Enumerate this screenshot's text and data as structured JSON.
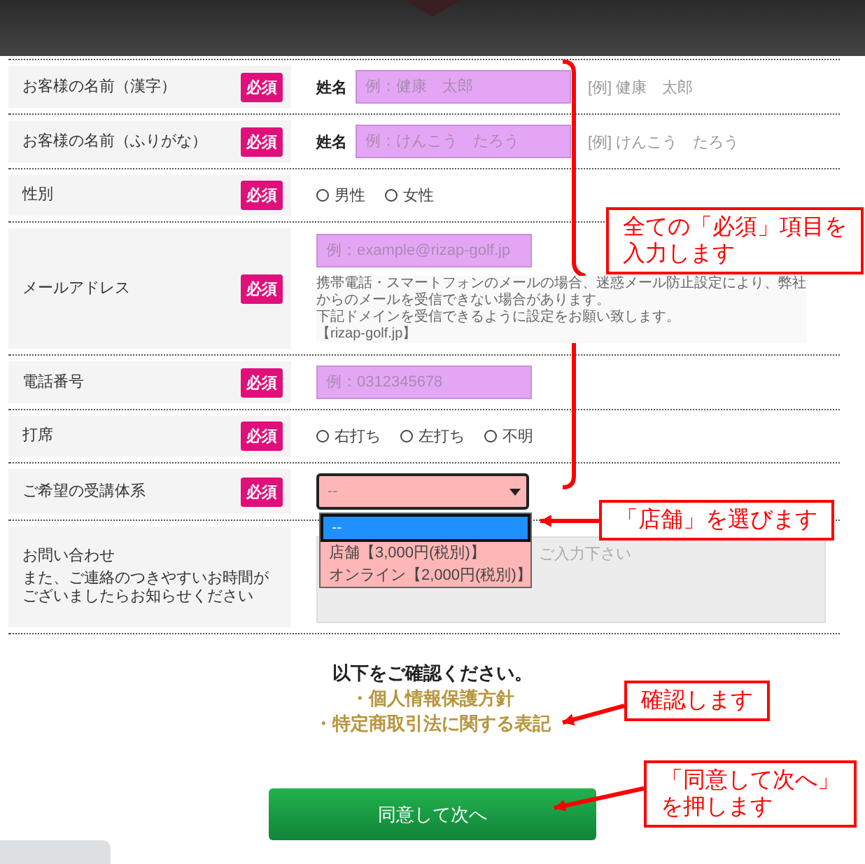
{
  "form": {
    "rows": [
      {
        "kind": "name",
        "label": "お客様の名前（漢字）",
        "badge": "必須",
        "sub_label": "姓名",
        "placeholder": "例：健康　太郎",
        "example": "[例] 健康　太郎"
      },
      {
        "kind": "name",
        "label": "お客様の名前（ふりがな）",
        "badge": "必須",
        "sub_label": "姓名",
        "placeholder": "例：けんこう　たろう",
        "example": "[例] けんこう　たろう"
      },
      {
        "kind": "radio",
        "label": "性別",
        "badge": "必須",
        "options": [
          {
            "label": "男性",
            "selected": false
          },
          {
            "label": "女性",
            "selected": false
          }
        ]
      },
      {
        "kind": "email",
        "label": "メールアドレス",
        "badge": "必須",
        "placeholder": "例：example@rizap-golf.jp",
        "note_lines": [
          "携帯電話・スマートフォンのメールの場合、迷惑メール防止設定により、弊社",
          "からのメールを受信できない場合があります。",
          "下記ドメインを受信できるように設定をお願い致します。",
          "【rizap-golf.jp】"
        ]
      },
      {
        "kind": "text",
        "label": "電話番号",
        "badge": "必須",
        "placeholder": "例：0312345678"
      },
      {
        "kind": "radio",
        "label": "打席",
        "badge": "必須",
        "options": [
          {
            "label": "右打ち",
            "selected": false
          },
          {
            "label": "左打ち",
            "selected": false
          },
          {
            "label": "不明",
            "selected": false
          }
        ]
      },
      {
        "kind": "select",
        "label": "ご希望の受講体系",
        "badge": "必須",
        "value": "--",
        "expanded": true,
        "options": [
          {
            "label": "--",
            "selected": true
          },
          {
            "label": "店舗【3,000円(税別)】",
            "selected": false
          },
          {
            "label": "オンライン【2,000円(税別)】",
            "selected": false
          }
        ]
      },
      {
        "kind": "textarea",
        "label": "お問い合わせ",
        "description_lines": [
          "また、ご連絡のつきやすいお時間が",
          "ございましたらお知らせください"
        ],
        "placeholder": "ご入力下さい"
      }
    ]
  },
  "confirmation": {
    "heading": "以下をご確認ください。",
    "links": [
      "・個人情報保護方針",
      "・特定商取引法に関する表記"
    ]
  },
  "submit_button": "同意して次へ",
  "annotations": [
    {
      "lines": [
        "全ての「必須」項目を",
        "入力します"
      ]
    },
    {
      "lines": [
        "「店舗」を選びます"
      ]
    },
    {
      "lines": [
        "確認します"
      ]
    },
    {
      "lines": [
        "「同意して次へ」",
        "を押します"
      ]
    }
  ]
}
